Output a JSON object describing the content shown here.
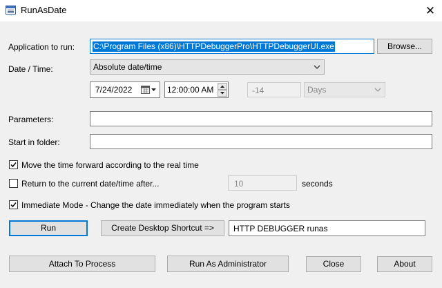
{
  "window": {
    "title": "RunAsDate",
    "close_glyph": "✕"
  },
  "labels": {
    "application": "Application to run:",
    "datetime": "Date / Time:",
    "parameters": "Parameters:",
    "start_in_folder": "Start in folder:",
    "seconds": "seconds"
  },
  "application": {
    "path": "C:\\Program Files (x86)\\HTTPDebuggerPro\\HTTPDebuggerUI.exe",
    "browse_label": "Browse..."
  },
  "datetime": {
    "mode": "Absolute date/time",
    "date": "7/24/2022",
    "time": "12:00:00 AM",
    "offset_value": "-14",
    "offset_unit": "Days"
  },
  "parameters": {
    "value": ""
  },
  "start_folder": {
    "value": ""
  },
  "options": {
    "move_time_forward": {
      "label": "Move the time forward according to the real time",
      "checked": true
    },
    "return_after": {
      "label": "Return to the current date/time after...",
      "checked": false,
      "value": "10"
    },
    "immediate_mode": {
      "label": "Immediate Mode - Change the date immediately when the program starts",
      "checked": true
    }
  },
  "actions": {
    "run_label": "Run",
    "create_shortcut_label": "Create Desktop Shortcut =>",
    "shortcut_name": "HTTP DEBUGGER runas"
  },
  "bottom": {
    "attach_label": "Attach To Process",
    "run_admin_label": "Run As Administrator",
    "close_label": "Close",
    "about_label": "About"
  },
  "colors": {
    "selection": "#0078d7",
    "window_bg": "#f0f0f0",
    "default_button_border": "#0078d7"
  },
  "icons": [
    "app-window-icon",
    "chevron-down-icon",
    "calendar-icon",
    "spin-up-icon",
    "spin-down-icon",
    "checkmark-icon",
    "close-icon"
  ]
}
